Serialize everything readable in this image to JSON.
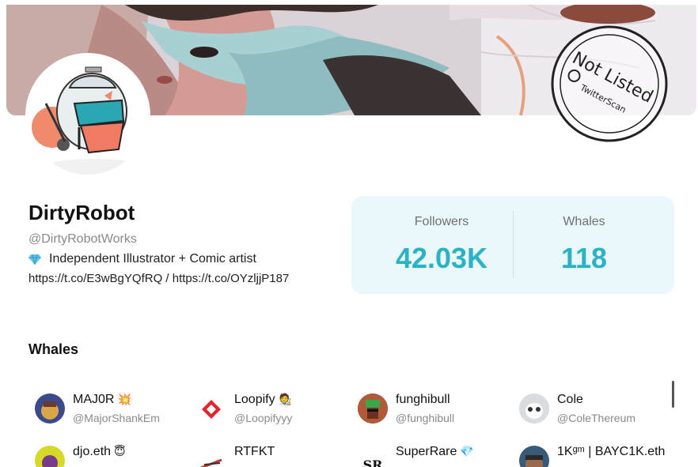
{
  "profile": {
    "name": "DirtyRobot",
    "handle": "@DirtyRobotWorks",
    "bio_icon": "diamond-icon",
    "bio": "Independent Illustrator + Comic artist",
    "links": "https://t.co/E3wBgYQfRQ / https://t.co/OYzljjP187"
  },
  "stamp": {
    "text": "Not Listed",
    "brand": "TwitterScan"
  },
  "stats": {
    "followers_label": "Followers",
    "followers_value": "42.03K",
    "whales_label": "Whales",
    "whales_value": "118"
  },
  "whales_section": {
    "title": "Whales",
    "items": [
      {
        "name": "MAJ0R",
        "emoji": "💥",
        "handle": "@MajorShankEm",
        "avatar_color": "#3a4a8a"
      },
      {
        "name": "Loopify",
        "emoji": "🧑‍🎨",
        "handle": "@Loopifyyy",
        "avatar_color": "#ffffff"
      },
      {
        "name": "funghibull",
        "emoji": "",
        "handle": "@funghibull",
        "avatar_color": "#8a3a2a"
      },
      {
        "name": "Cole",
        "emoji": "",
        "handle": "@ColeThereum",
        "avatar_color": "#c9ccd0"
      },
      {
        "name": "djo.eth",
        "emoji": "😇",
        "handle": "",
        "avatar_color": "#d6d82a"
      },
      {
        "name": "RTFKT",
        "emoji": "",
        "handle": "",
        "avatar_color": "#ffffff"
      },
      {
        "name": "SuperRare",
        "emoji": "💎",
        "handle": "",
        "avatar_color": "#ffffff"
      },
      {
        "name": "1Kᵍᵐ | BAYC1K.eth",
        "emoji": "",
        "handle": "",
        "avatar_color": "#3a5a7a"
      }
    ]
  },
  "colors": {
    "accent": "#2bb3c5",
    "stats_bg": "#eaf8fb"
  }
}
